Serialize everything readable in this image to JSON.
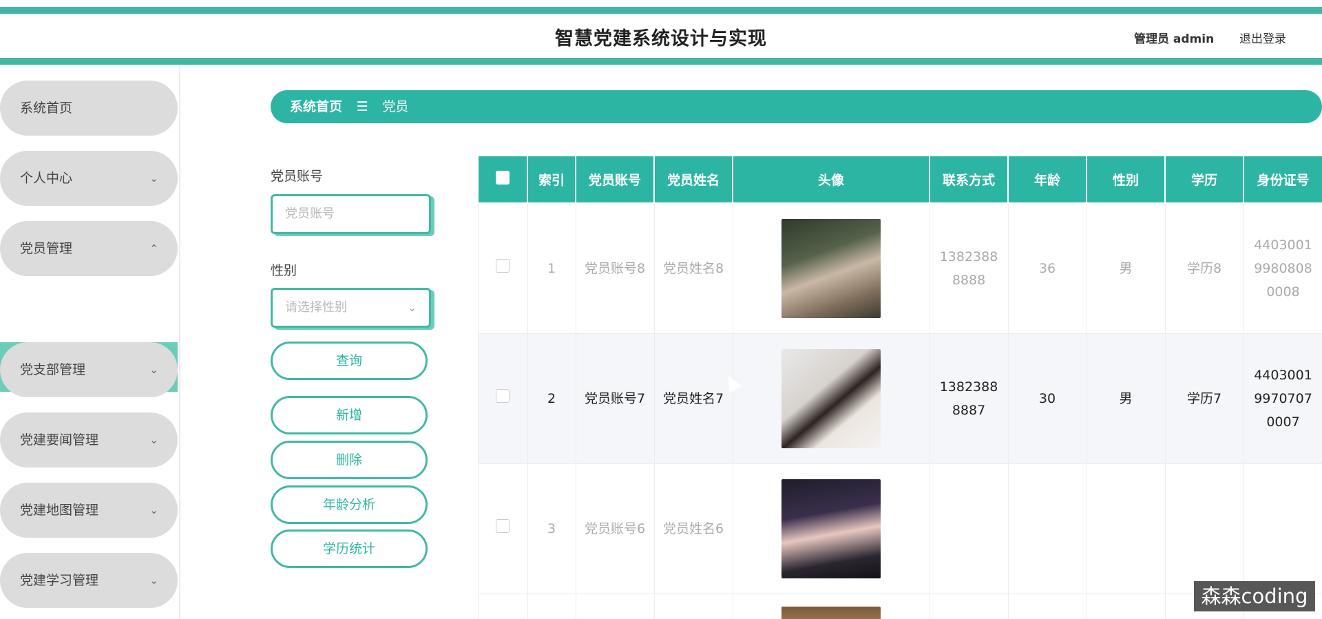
{
  "header": {
    "title": "智慧党建系统设计与实现",
    "admin_label": "管理员 admin",
    "logout_label": "退出登录"
  },
  "sidebar": {
    "items": [
      {
        "label": "系统首页",
        "has_chevron": false,
        "chevron": ""
      },
      {
        "label": "个人中心",
        "has_chevron": true,
        "chevron": "⌄"
      },
      {
        "label": "党员管理",
        "has_chevron": true,
        "chevron": "⌃"
      },
      {
        "label": "党支部管理",
        "has_chevron": true,
        "chevron": "⌄"
      },
      {
        "label": "党建要闻管理",
        "has_chevron": true,
        "chevron": "⌄"
      },
      {
        "label": "党建地图管理",
        "has_chevron": true,
        "chevron": "⌄"
      },
      {
        "label": "党建学习管理",
        "has_chevron": true,
        "chevron": "⌄"
      }
    ],
    "active_sub": "党员"
  },
  "breadcrumb": {
    "home": "系统首页",
    "separator": "☰",
    "current": "党员"
  },
  "search_form": {
    "account_label": "党员账号",
    "account_placeholder": "党员账号",
    "gender_label": "性别",
    "gender_placeholder": "请选择性别",
    "buttons": {
      "query": "查询",
      "add": "新增",
      "delete": "删除",
      "age_analysis": "年龄分析",
      "education_stats": "学历统计"
    }
  },
  "table": {
    "columns": [
      "",
      "索引",
      "党员账号",
      "党员姓名",
      "头像",
      "联系方式",
      "年龄",
      "性别",
      "学历",
      "身份证号"
    ],
    "rows": [
      {
        "index": "1",
        "account": "党员账号8",
        "name": "党员姓名8",
        "avatar": "photo",
        "phone": "13823888888",
        "age": "36",
        "gender": "男",
        "education": "学历8",
        "id_number": "440300199808080008"
      },
      {
        "index": "2",
        "account": "党员账号7",
        "name": "党员姓名7",
        "avatar": "photo",
        "phone": "13823888887",
        "age": "30",
        "gender": "男",
        "education": "学历7",
        "id_number": "440300199707070007"
      },
      {
        "index": "3",
        "account": "党员账号6",
        "name": "党员姓名6",
        "avatar": "photo",
        "phone": "",
        "age": "",
        "gender": "",
        "education": "",
        "id_number": ""
      }
    ]
  },
  "watermark": "森森coding",
  "colors": {
    "primary": "#2db5a3",
    "accent_light": "#6cccbc",
    "sidebar_item_bg": "#dcdcdc"
  }
}
